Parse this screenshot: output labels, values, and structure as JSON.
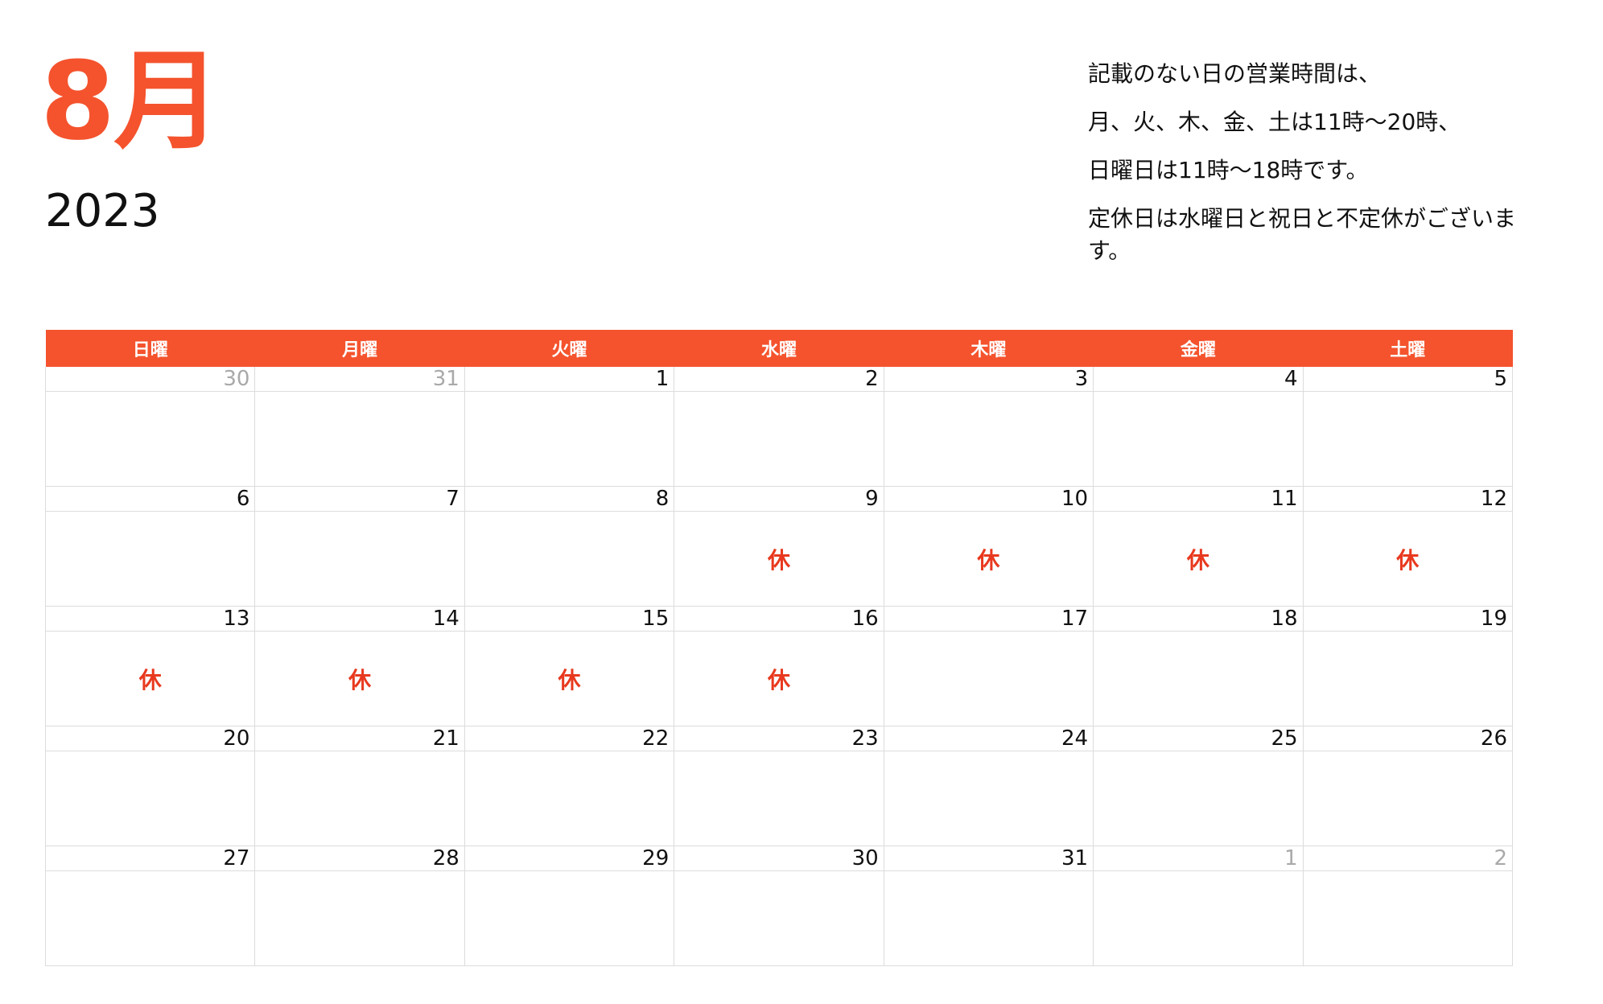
{
  "header": {
    "month": "8月",
    "year": "2023"
  },
  "notes": [
    "記載のない日の営業時間は、",
    "月、火、木、金、土は11時〜20時、",
    "日曜日は11時〜18時です。",
    "定休日は水曜日と祝日と不定休がございます。"
  ],
  "calendar": {
    "weekdays": [
      "日曜",
      "月曜",
      "火曜",
      "水曜",
      "木曜",
      "金曜",
      "土曜"
    ],
    "closed_mark": "休",
    "weeks": [
      {
        "days": [
          "30",
          "31",
          "1",
          "2",
          "3",
          "4",
          "5"
        ],
        "muted": [
          true,
          true,
          false,
          false,
          false,
          false,
          false
        ],
        "marks": [
          "",
          "",
          "",
          "",
          "",
          "",
          ""
        ]
      },
      {
        "days": [
          "6",
          "7",
          "8",
          "9",
          "10",
          "11",
          "12"
        ],
        "muted": [
          false,
          false,
          false,
          false,
          false,
          false,
          false
        ],
        "marks": [
          "",
          "",
          "",
          "休",
          "休",
          "休",
          "休"
        ]
      },
      {
        "days": [
          "13",
          "14",
          "15",
          "16",
          "17",
          "18",
          "19"
        ],
        "muted": [
          false,
          false,
          false,
          false,
          false,
          false,
          false
        ],
        "marks": [
          "休",
          "休",
          "休",
          "休",
          "",
          "",
          ""
        ]
      },
      {
        "days": [
          "20",
          "21",
          "22",
          "23",
          "24",
          "25",
          "26"
        ],
        "muted": [
          false,
          false,
          false,
          false,
          false,
          false,
          false
        ],
        "marks": [
          "",
          "",
          "",
          "",
          "",
          "",
          ""
        ]
      },
      {
        "days": [
          "27",
          "28",
          "29",
          "30",
          "31",
          "1",
          "2"
        ],
        "muted": [
          false,
          false,
          false,
          false,
          false,
          true,
          true
        ],
        "marks": [
          "",
          "",
          "",
          "",
          "",
          "",
          ""
        ]
      }
    ]
  },
  "colors": {
    "accent": "#f4532d",
    "closed": "#e8391f",
    "muted": "#a9a9a9",
    "grid": "#dcdcdc"
  }
}
